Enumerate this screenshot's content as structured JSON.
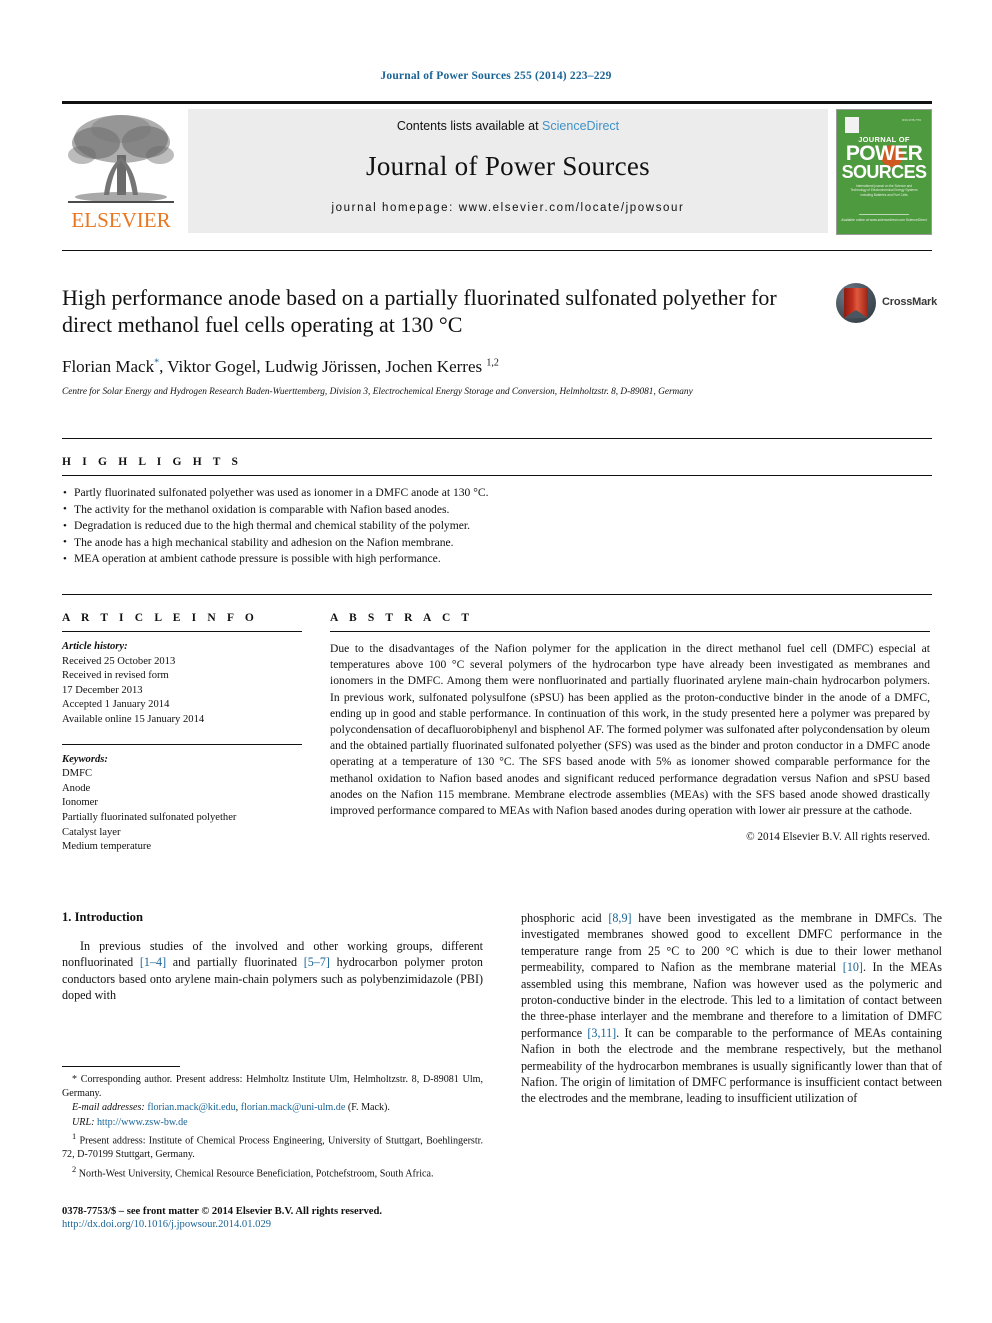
{
  "running_head": "Journal of Power Sources 255 (2014) 223–229",
  "masthead": {
    "contents_prefix": "Contents lists available at",
    "sciencedirect": "ScienceDirect",
    "journal_name": "Journal of Power Sources",
    "homepage": "journal homepage: www.elsevier.com/locate/jpowsour",
    "publisher": "ELSEVIER",
    "cover": {
      "journal_of": "JOURNAL OF",
      "power": "POWER",
      "sources": "SOURCES",
      "issn": "ISSN 0378-7753",
      "subtitle": "International journal on the Science and Technology of Electrochemical Energy Systems including Batteries and Fuel Cells",
      "footer": "Available online at www.sciencedirect.com  ScienceDirect"
    }
  },
  "article": {
    "title": "High performance anode based on a partially fluorinated sulfonated polyether for direct methanol fuel cells operating at 130 °C",
    "authors_html": "Florian Mack<sup class=\"star\">*</sup>, Viktor Gogel, Ludwig Jörissen, Jochen Kerres <sup class=\"supblue\">1,2</sup>",
    "affiliation": "Centre for Solar Energy and Hydrogen Research Baden-Wuerttemberg, Division 3, Electrochemical Energy Storage and Conversion, Helmholtzstr. 8, D-89081, Germany",
    "crossmark_label": "CrossMark"
  },
  "highlights": {
    "label": "H I G H L I G H T S",
    "items": [
      "Partly fluorinated sulfonated polyether was used as ionomer in a DMFC anode at 130 °C.",
      "The activity for the methanol oxidation is comparable with Nafion based anodes.",
      "Degradation is reduced due to the high thermal and chemical stability of the polymer.",
      "The anode has a high mechanical stability and adhesion on the Nafion membrane.",
      "MEA operation at ambient cathode pressure is possible with high performance."
    ]
  },
  "article_info": {
    "label": "A R T I C L E  I N F O",
    "history_heading": "Article history:",
    "history_lines": [
      "Received 25 October 2013",
      "Received in revised form",
      "17 December 2013",
      "Accepted 1 January 2014",
      "Available online 15 January 2014"
    ],
    "keywords_heading": "Keywords:",
    "keywords": [
      "DMFC",
      "Anode",
      "Ionomer",
      "Partially fluorinated sulfonated polyether",
      "Catalyst layer",
      "Medium temperature"
    ]
  },
  "abstract": {
    "label": "A B S T R A C T",
    "text": "Due to the disadvantages of the Nafion polymer for the application in the direct methanol fuel cell (DMFC) especial at temperatures above 100 °C several polymers of the hydrocarbon type have already been investigated as membranes and ionomers in the DMFC. Among them were nonfluorinated and partially fluorinated arylene main-chain hydrocarbon polymers. In previous work, sulfonated polysulfone (sPSU) has been applied as the proton-conductive binder in the anode of a DMFC, ending up in good and stable performance. In continuation of this work, in the study presented here a polymer was prepared by polycondensation of decafluorobiphenyl and bisphenol AF. The formed polymer was sulfonated after polycondensation by oleum and the obtained partially fluorinated sulfonated polyether (SFS) was used as the binder and proton conductor in a DMFC anode operating at a temperature of 130 °C. The SFS based anode with 5% as ionomer showed comparable performance for the methanol oxidation to Nafion based anodes and significant reduced performance degradation versus Nafion and sPSU based anodes on the Nafion 115 membrane. Membrane electrode assemblies (MEAs) with the SFS based anode showed drastically improved performance compared to MEAs with Nafion based anodes during operation with lower air pressure at the cathode.",
    "copyright": "© 2014 Elsevier B.V. All rights reserved."
  },
  "body": {
    "section_heading": "1. Introduction",
    "left_paragraph_html": "In previous studies of the involved and other working groups, different nonfluorinated <span class=\"ref\">[1–4]</span> and partially fluorinated <span class=\"ref\">[5–7]</span> hydrocarbon polymer proton conductors based onto arylene main-chain polymers such as polybenzimidazole (PBI) doped with",
    "right_paragraph_html": "phosphoric acid <span class=\"ref\">[8,9]</span> have been investigated as the membrane in DMFCs. The investigated membranes showed good to excellent DMFC performance in the temperature range from 25 °C to 200 °C which is due to their lower methanol permeability, compared to Nafion as the membrane material <span class=\"ref\">[10]</span>. In the MEAs assembled using this membrane, Nafion was however used as the polymeric and proton-conductive binder in the electrode. This led to a limitation of contact between the three-phase interlayer and the membrane and therefore to a limitation of DMFC performance <span class=\"ref\">[3,11]</span>. It can be comparable to the performance of MEAs containing Nafion in both the electrode and the membrane respectively, but the methanol permeability of the hydrocarbon membranes is usually significantly lower than that of Nafion. The origin of limitation of DMFC performance is insufficient contact between the electrodes and the membrane, leading to insufficient utilization of"
  },
  "footnotes": {
    "corresponding_html": "* Corresponding author. Present address: Helmholtz Institute Ulm, Helmholtzstr. 8, D-89081 Ulm, Germany.",
    "email_html": "<em>E-mail addresses:</em> <span class=\"link\">florian.mack@kit.edu</span>, <span class=\"link\">florian.mack@uni-ulm.de</span> (F. Mack).",
    "url_html": "<em>URL:</em> <span class=\"link\">http://www.zsw-bw.de</span>",
    "note1_html": "<sup>1</sup> Present address: Institute of Chemical Process Engineering, University of Stuttgart, Boehlingerstr. 72, D-70199 Stuttgart, Germany.",
    "note2_html": "<sup>2</sup> North-West University, Chemical Resource Beneficiation, Potchefstroom, South Africa."
  },
  "page_footer": {
    "issn_line": "0378-7753/$ – see front matter © 2014 Elsevier B.V. All rights reserved.",
    "doi": "http://dx.doi.org/10.1016/j.jpowsour.2014.01.029"
  }
}
